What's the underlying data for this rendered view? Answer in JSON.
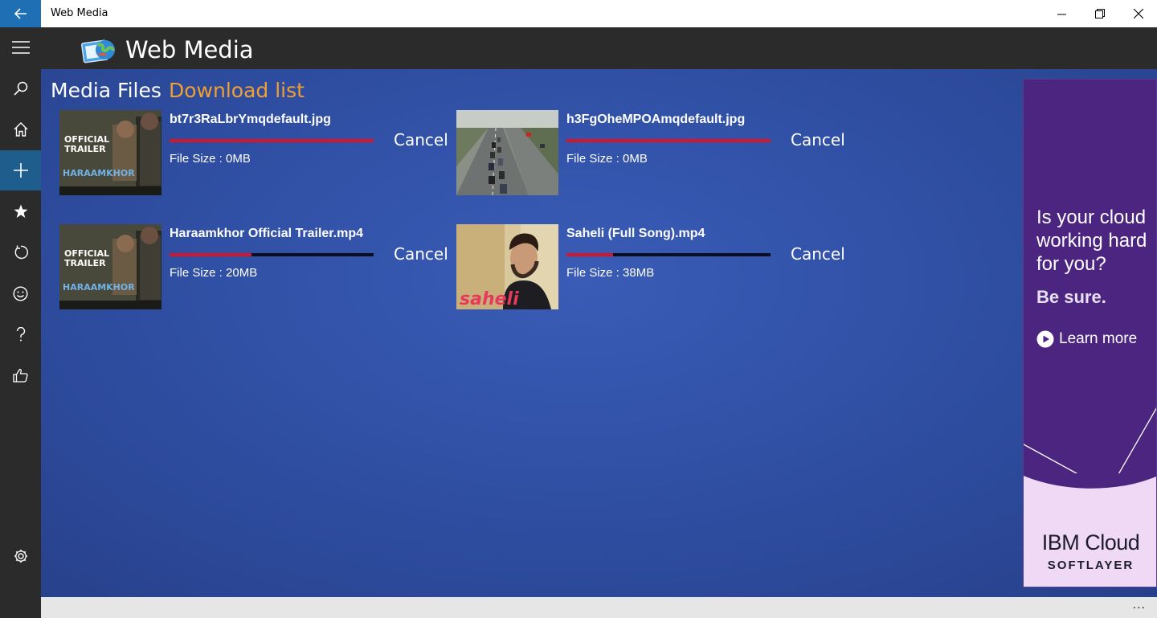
{
  "window": {
    "title": "Web Media",
    "controls": [
      "minimize",
      "restore",
      "close"
    ]
  },
  "nav_rail": {
    "items": [
      {
        "icon": "hamburger-menu-icon"
      },
      {
        "icon": "search-icon"
      },
      {
        "icon": "home-icon"
      },
      {
        "icon": "add-icon",
        "active": true
      },
      {
        "icon": "star-icon"
      },
      {
        "icon": "refresh-icon"
      },
      {
        "icon": "smiley-icon"
      },
      {
        "icon": "help-icon"
      },
      {
        "icon": "thumbs-up-icon"
      },
      {
        "icon": "settings-icon"
      }
    ]
  },
  "header": {
    "app_title": "Web Media"
  },
  "tabs": {
    "media_files": "Media Files",
    "download_list": "Download list",
    "active": "download_list"
  },
  "downloads": [
    {
      "filename": "bt7r3RaLbrYmqdefault.jpg",
      "file_size": "File Size :  0MB",
      "progress": 1.0,
      "cancel_label": "Cancel",
      "thumb_text": [
        "OFFICIAL",
        "TRAILER",
        "HARAAMKHOR"
      ]
    },
    {
      "filename": "h3FgOheMPOAmqdefault.jpg",
      "file_size": "File Size :  0MB",
      "progress": 1.0,
      "cancel_label": "Cancel"
    },
    {
      "filename": "Haraamkhor  Official Trailer.mp4",
      "file_size": "File Size :  20MB",
      "progress": 0.4,
      "cancel_label": "Cancel",
      "thumb_text": [
        "OFFICIAL",
        "TRAILER",
        "HARAAMKHOR"
      ]
    },
    {
      "filename": "Saheli (Full Song).mp4",
      "file_size": "File Size :  38MB",
      "progress": 0.23,
      "cancel_label": "Cancel",
      "thumb_text": [
        "saheli"
      ]
    }
  ],
  "ad": {
    "headline": "Is your cloud working hard for you?",
    "tagline": "Be sure.",
    "cta": "Learn more",
    "brand": "IBM Cloud",
    "sub_brand": "SOFTLAYER"
  },
  "bottom_bar": {
    "more_label": "..."
  },
  "colors": {
    "accent": "#f0a033",
    "progress_fill": "#d4162b",
    "rail_bg": "#2b2b2b",
    "main_bg": "#3050a5",
    "ad_bg": "#4b2580"
  }
}
